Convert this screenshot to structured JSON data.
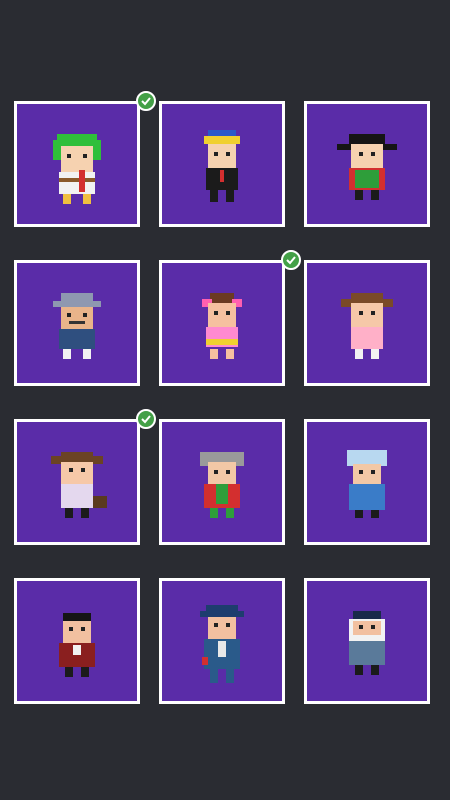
{
  "screen": {
    "background": "#2a2c32",
    "card_color": "#5a2ca8",
    "card_border": "#ffffff",
    "check_color": "#43a047"
  },
  "characters": [
    {
      "id": "green-hair-kid",
      "icon": "green-hair-kid-sprite",
      "unlocked": true
    },
    {
      "id": "blue-cap-kid",
      "icon": "blue-cap-kid-sprite",
      "unlocked": false
    },
    {
      "id": "black-pigtails-girl",
      "icon": "black-pigtails-girl-sprite",
      "unlocked": false
    },
    {
      "id": "grey-hat-man",
      "icon": "grey-hat-man-sprite",
      "unlocked": false
    },
    {
      "id": "pink-bow-girl",
      "icon": "pink-bow-girl-sprite",
      "unlocked": true
    },
    {
      "id": "brown-pigtails-girl",
      "icon": "brown-pigtails-girl-sprite",
      "unlocked": false
    },
    {
      "id": "pigtails-girl-with-dog",
      "icon": "pigtails-girl-with-dog-sprite",
      "unlocked": true
    },
    {
      "id": "grey-hair-grandpa",
      "icon": "grey-hair-grandpa-sprite",
      "unlocked": false
    },
    {
      "id": "blue-hair-grandma",
      "icon": "blue-hair-grandma-sprite",
      "unlocked": false
    },
    {
      "id": "red-suit-man",
      "icon": "red-suit-man-sprite",
      "unlocked": false
    },
    {
      "id": "blue-suit-detective",
      "icon": "blue-suit-detective-sprite",
      "unlocked": false
    },
    {
      "id": "bearded-old-man",
      "icon": "bearded-old-man-sprite",
      "unlocked": false
    }
  ]
}
